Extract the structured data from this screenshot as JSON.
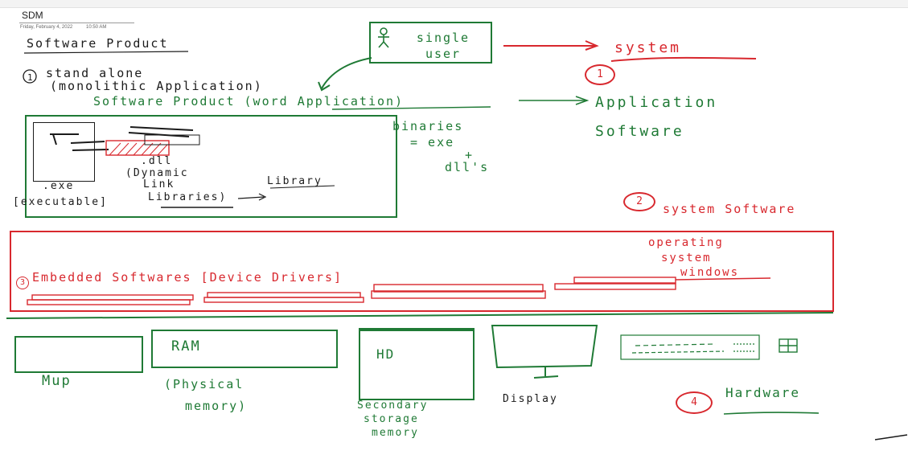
{
  "notebook": {
    "page_title": "SDM",
    "date": "Friday, February 4, 2022",
    "time": "10:50 AM"
  },
  "notes": {
    "heading": "Software Product",
    "item1_line1": "stand alone",
    "item1_line2": "(monolithic Application)",
    "software_product": "Software Product (word Application)",
    "single_user": "single user",
    "system": "system",
    "system_number": "1",
    "application_software": "Application Software",
    "binaries": "binaries",
    "binaries_eq": "= exe",
    "binaries_plus": "+",
    "dlls": "dll's",
    "exe_label": ".exe",
    "executable_label": "[executable]",
    "dll_label": ".dll",
    "dynamic": "(Dynamic",
    "link": "Link",
    "libraries": "Libraries)",
    "library": "Library",
    "system_software_number": "2",
    "system_software": "system Software",
    "operating": "operating",
    "system_word": "system",
    "windows": "windows",
    "embedded_number": "3",
    "embedded": "Embedded Softwares [Device Drivers]",
    "mup": "Mup",
    "ram": "RAM",
    "physical_memory_line1": "(Physical",
    "physical_memory_line2": "memory)",
    "hd": "HD",
    "secondary_line1": "Secondary",
    "secondary_line2": "storage",
    "secondary_line3": "memory",
    "display": "Display",
    "hardware_number": "4",
    "hardware": "Hardware"
  },
  "colors": {
    "green_ink": "#1f7a35",
    "red_ink": "#d8282e",
    "black_ink": "#1b1b1b"
  },
  "icons": [
    "person-icon",
    "keyboard-icon",
    "monitor-icon"
  ]
}
